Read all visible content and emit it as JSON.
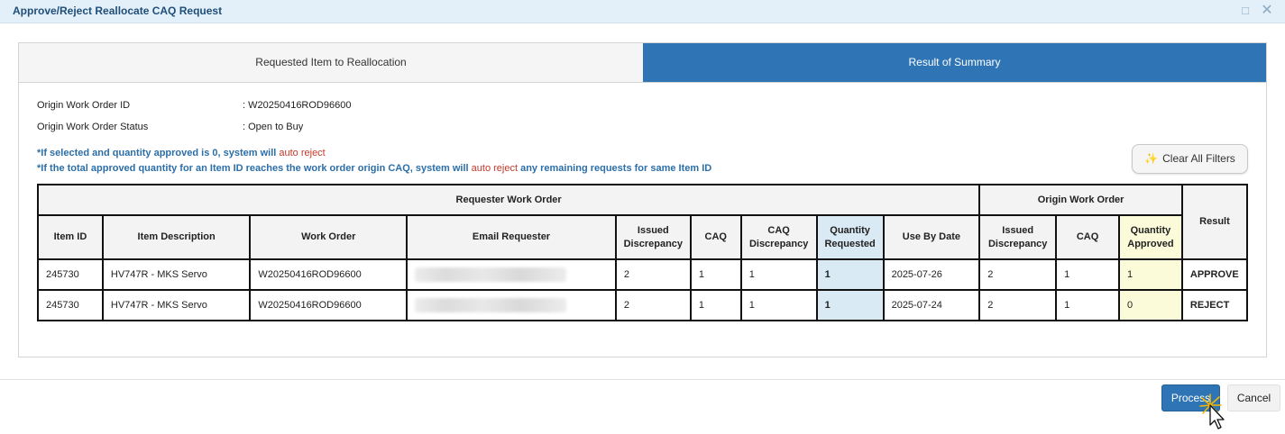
{
  "window": {
    "title": "Approve/Reject Reallocate CAQ Request",
    "maximize_icon": "maximize-icon",
    "close_icon": "close-icon"
  },
  "tabs": [
    {
      "label": "Requested Item to Reallocation",
      "active": false
    },
    {
      "label": "Result of Summary",
      "active": true
    }
  ],
  "info": {
    "origin_work_order_id_label": "Origin Work Order ID",
    "origin_work_order_id_value": ": W20250416ROD96600",
    "origin_work_order_status_label": "Origin Work Order Status",
    "origin_work_order_status_value": ": Open to Buy"
  },
  "notes": {
    "note1_prefix": "*If selected and quantity approved is 0, system will ",
    "note1_red": "auto reject",
    "note2_prefix": "*If the total approved quantity for an Item ID reaches the work order origin CAQ, system will ",
    "note2_red": "auto reject",
    "note2_suffix": " any remaining requests for same Item ID"
  },
  "clear_filters_label": "Clear All Filters",
  "table": {
    "group_requester": "Requester Work Order",
    "group_origin": "Origin Work Order",
    "result_header": "Result",
    "headers": {
      "item_id": "Item ID",
      "item_description": "Item Description",
      "work_order": "Work Order",
      "email_requester": "Email Requester",
      "issued_discrepancy": "Issued Discrepancy",
      "caq": "CAQ",
      "caq_discrepancy": "CAQ Discrepancy",
      "quantity_requested": "Quantity Requested",
      "use_by_date": "Use By Date",
      "origin_issued_discrepancy": "Issued Discrepancy",
      "origin_caq": "CAQ",
      "quantity_approved": "Quantity Approved"
    },
    "rows": [
      {
        "item_id": "245730",
        "item_description": "HV747R - MKS Servo",
        "work_order": "W20250416ROD96600",
        "issued_discrepancy": "2",
        "caq": "1",
        "caq_discrepancy": "1",
        "quantity_requested": "1",
        "use_by_date": "2025-07-26",
        "origin_issued_discrepancy": "2",
        "origin_caq": "1",
        "quantity_approved": "1",
        "result": "APPROVE"
      },
      {
        "item_id": "245730",
        "item_description": "HV747R - MKS Servo",
        "work_order": "W20250416ROD96600",
        "issued_discrepancy": "2",
        "caq": "1",
        "caq_discrepancy": "1",
        "quantity_requested": "1",
        "use_by_date": "2025-07-24",
        "origin_issued_discrepancy": "2",
        "origin_caq": "1",
        "quantity_approved": "0",
        "result": "REJECT"
      }
    ]
  },
  "footer": {
    "process_label": "Process",
    "cancel_label": "Cancel"
  },
  "colors": {
    "accent": "#2f74b5",
    "approve": "#2e8b57",
    "reject": "#c0392b",
    "quantity_requested_bg": "#d9eaf5",
    "quantity_approved_bg": "#fbfbd9"
  }
}
